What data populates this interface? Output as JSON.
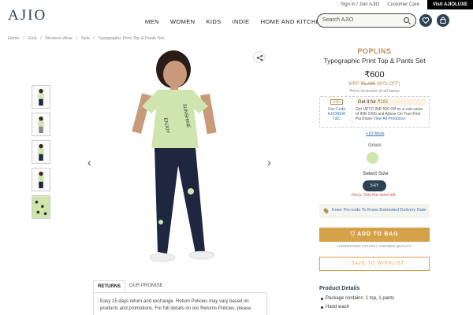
{
  "topbar": {
    "signin": "Sign In / Join AJIO",
    "care": "Customer Care",
    "luxe": "Visit AJIOLUXE"
  },
  "logo": "AJIO",
  "nav": [
    "MEN",
    "WOMEN",
    "KIDS",
    "INDIE",
    "HOME AND KITCHEN"
  ],
  "search": {
    "placeholder": "Search AJIO"
  },
  "breadcrumb": [
    "Home",
    "/",
    "Girls",
    "/",
    "Western Wear",
    "/",
    "Sets",
    "/",
    "Typographic Print Top & Pants Set"
  ],
  "product": {
    "brand": "POPLINS",
    "title": "Typographic Print Top & Pants Set",
    "price": "₹600",
    "mrp_label": "MRP",
    "mrp": "₹1,499",
    "discount": "(60% OFF)",
    "tax_note": "Price inclusive of all taxes"
  },
  "offer": {
    "tag": "Offer",
    "use_code_label": "Use Code",
    "code": "AJIONEW",
    "tnc": "T&C",
    "get_it_for": "Get it for",
    "offer_price": "₹181",
    "desc": "Get UPTO INR 500 Off on a cart value of INR 1990 and Above On Your First Purchase",
    "view_all": "View All Products»"
  },
  "more_offers": "+10 More",
  "color": {
    "label": "Green",
    "swatch": "#cfe5b0"
  },
  "size": {
    "label": "Select Size",
    "selected": "5-6Y",
    "stock_note": "Hurry, Only few items left"
  },
  "pincode": "Enter Pin-code To Know Estimated Delivery Date",
  "actions": {
    "add_to_bag": "ADD TO BAG",
    "handpicked": "HANDPICKED STYLES | ASSURED QUALITY",
    "wishlist": "SAVE TO WISHLIST"
  },
  "details": {
    "title": "Product Details",
    "items": [
      "Package contains: 1 top, 1 pants",
      "Hand wash"
    ]
  },
  "tabs": {
    "returns": "RETURNS",
    "promise": "OUR PROMISE"
  },
  "returns_text": "Easy 15 days return and exchange. Return Policies may vary based on products and promotions. For full details on our Returns Policies, please",
  "colors": {
    "primary": "#2c4152",
    "accent": "#d5a249",
    "brand": "#b9905b",
    "link": "#3a6fb0",
    "alert": "#e14b4b"
  },
  "icons": {
    "search": "search-icon",
    "wishlist": "heart-icon",
    "bag": "bag-icon",
    "share": "share-icon",
    "prev": "chevron-left-icon",
    "next": "chevron-right-icon",
    "pin": "location-icon"
  }
}
